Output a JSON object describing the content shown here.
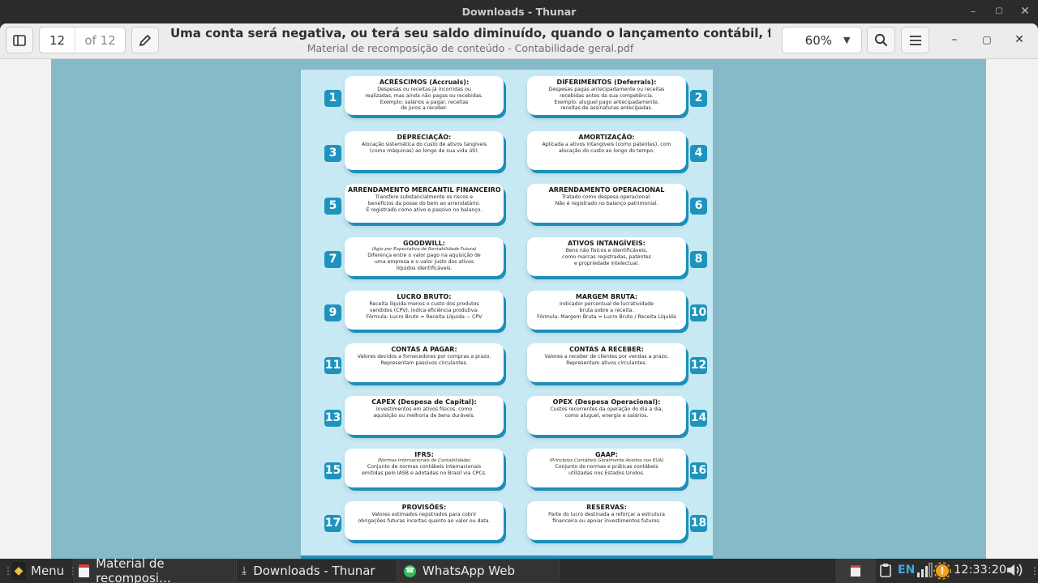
{
  "window": {
    "title": "Downloads - Thunar",
    "controls": [
      "minimize",
      "maximize",
      "close"
    ]
  },
  "viewer": {
    "page_current": "12",
    "page_of": "of 12",
    "doc_title": "Uma conta será negativa, ou terá seu saldo diminuído, quando o lançamento contábil, for diferente …",
    "doc_subtitle": "Material de recomposição de conteúdo - Contabilidade geral.pdf",
    "zoom": "60%"
  },
  "cards": [
    {
      "n": "1",
      "title": "ACRÉSCIMOS (Accruals):",
      "sub": "",
      "body": "Despesas ou receitas já incorridas ou\nrealizadas, mas ainda não pagas ou recebidas.\nExemplo: salários a pagar, receitas\nde juros a receber."
    },
    {
      "n": "2",
      "title": "DIFERIMENTOS (Deferrals):",
      "sub": "",
      "body": "Despesas pagas antecipadamente ou receitas\nrecebidas antes da sua competência.\nExemplo: aluguel pago antecipadamente,\nreceitas de assinaturas antecipadas."
    },
    {
      "n": "3",
      "title": "DEPRECIAÇÃO:",
      "sub": "",
      "body": "Alocação sistemática do custo de ativos tangíveis\n(como máquinas) ao longo de sua vida útil."
    },
    {
      "n": "4",
      "title": "AMORTIZAÇÃO:",
      "sub": "",
      "body": "Aplicada a ativos intangíveis (como patentes), com\nalocação do custo ao longo do tempo."
    },
    {
      "n": "5",
      "title": "ARRENDAMENTO MERCANTIL FINANCEIRO",
      "sub": "",
      "body": "Transfere substancialmente os riscos e\nbenefícios da posse do bem ao arrendatário.\nÉ registrado como ativo e passivo no balanço."
    },
    {
      "n": "6",
      "title": "ARRENDAMENTO OPERACIONAL",
      "sub": "",
      "body": "Tratado como despesa operacional.\nNão é registrado no balanço patrimonial."
    },
    {
      "n": "7",
      "title": "GOODWILL:",
      "sub": "(Ágio por Expectativa de Rentabilidade Futura)",
      "body": "Diferença entre o valor pago na aquisição de\numa empresa e o valor justo dos ativos\nlíquidos identificáveis."
    },
    {
      "n": "8",
      "title": "ATIVOS INTANGÍVEIS:",
      "sub": "",
      "body": "Bens não físicos e identificáveis,\ncomo marcas registradas, patentes\ne propriedade intelectual."
    },
    {
      "n": "9",
      "title": "LUCRO BRUTO:",
      "sub": "",
      "body": "Receita líquida menos o custo dos produtos\nvendidos (CPV), indica eficiência produtiva.\nFórmula: Lucro Bruto = Receita Líquida − CPV"
    },
    {
      "n": "10",
      "title": "MARGEM BRUTA:",
      "sub": "",
      "body": "Indicador percentual de lucratividade\nbruta sobre a receita.\nFórmula: Margem Bruta = Lucro Bruto / Receita Líquida"
    },
    {
      "n": "11",
      "title": "CONTAS A PAGAR:",
      "sub": "",
      "body": "Valores devidos a fornecedores por compras a prazo.\nRepresentam passivos circulantes."
    },
    {
      "n": "12",
      "title": "CONTAS A RECEBER:",
      "sub": "",
      "body": "Valores a receber de clientes por vendas a prazo.\nRepresentam ativos circulantes."
    },
    {
      "n": "13",
      "title": "CAPEX (Despesa de Capital):",
      "sub": "",
      "body": "Investimentos em ativos físicos, como\naquisição ou melhoria de bens duráveis."
    },
    {
      "n": "14",
      "title": "OPEX (Despesa Operacional):",
      "sub": "",
      "body": "Custos recorrentes da operação do dia a dia,\ncomo aluguel, energia e salários."
    },
    {
      "n": "15",
      "title": "IFRS:",
      "sub": "(Normas Internacionais de Contabilidade)",
      "body": "Conjunto de normas contábeis internacionais\nemitidas pelo IASB e adotadas no Brasil via CPCs."
    },
    {
      "n": "16",
      "title": "GAAP:",
      "sub": "(Princípios Contábeis Geralmente Aceitos nos EUA)",
      "body": "Conjunto de normas e práticas contábeis\nutilizadas nos Estados Unidos."
    },
    {
      "n": "17",
      "title": "PROVISÕES:",
      "sub": "",
      "body": "Valores estimados registrados para cobrir\nobrigações futuras incertas quanto ao valor ou data."
    },
    {
      "n": "18",
      "title": "RESERVAS:",
      "sub": "",
      "body": "Parte do lucro destinada a reforçar a estrutura\nfinanceira ou apoiar investimentos futuros."
    }
  ],
  "taskbar": {
    "menu_label": "Menu",
    "tasks": [
      {
        "label": "Material de recomposi…",
        "icon": "pdf-document-icon"
      },
      {
        "label": "Downloads - Thunar",
        "icon": "download-folder-icon"
      },
      {
        "label": "WhatsApp Web",
        "icon": "whatsapp-icon"
      }
    ],
    "keyboard_layout": "EN",
    "clock": "12:33:20"
  },
  "colors": {
    "doc_background": "#86bac8",
    "page_background": "#c7e9f3",
    "accent_blue": "#1e93bd",
    "taskbar": "#2c2c2c"
  }
}
